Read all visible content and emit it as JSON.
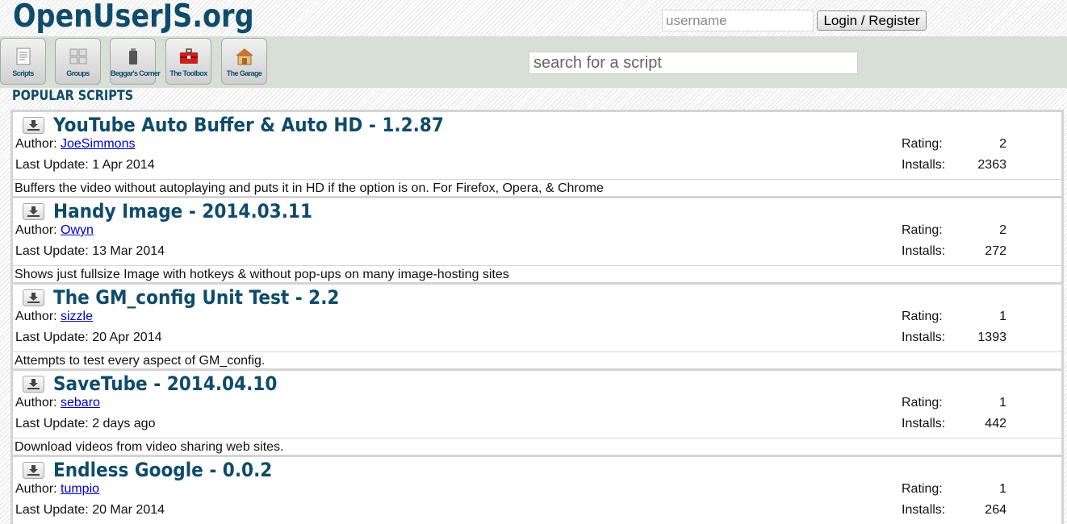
{
  "header": {
    "logo": "OpenUserJS.org",
    "username_placeholder": "username",
    "login_label": "Login / Register"
  },
  "nav": {
    "items": [
      {
        "label": "Scripts",
        "icon": "document-icon"
      },
      {
        "label": "Groups",
        "icon": "grid-icon"
      },
      {
        "label": "Beggar's Corner",
        "icon": "cup-icon"
      },
      {
        "label": "The Toolbox",
        "icon": "toolbox-icon"
      },
      {
        "label": "The Garage",
        "icon": "house-icon"
      }
    ],
    "search_placeholder": "search for a script"
  },
  "section_title": "POPULAR SCRIPTS",
  "labels": {
    "author": "Author:",
    "last_update": "Last Update:",
    "rating": "Rating:",
    "installs": "Installs:"
  },
  "scripts": [
    {
      "title": "YouTube Auto Buffer & Auto HD - 1.2.87",
      "author": "JoeSimmons",
      "last_update": "1 Apr 2014",
      "rating": "2",
      "installs": "2363",
      "description": "Buffers the video without autoplaying and puts it in HD if the option is on. For Firefox, Opera, & Chrome"
    },
    {
      "title": "Handy Image - 2014.03.11",
      "author": "Owyn",
      "last_update": "13 Mar 2014",
      "rating": "2",
      "installs": "272",
      "description": "Shows just fullsize Image with hotkeys & without pop-ups on many image-hosting sites"
    },
    {
      "title": "The GM_config Unit Test - 2.2",
      "author": "sizzle",
      "last_update": "20 Apr 2014",
      "rating": "1",
      "installs": "1393",
      "description": "Attempts to test every aspect of GM_config."
    },
    {
      "title": "SaveTube - 2014.04.10",
      "author": "sebaro",
      "last_update": "2 days ago",
      "rating": "1",
      "installs": "442",
      "description": "Download videos from video sharing web sites."
    },
    {
      "title": "Endless Google - 0.0.2",
      "author": "tumpio",
      "last_update": "20 Mar 2014",
      "rating": "1",
      "installs": "264",
      "description": ""
    }
  ],
  "colors": {
    "brand": "#0f4b6b",
    "nav_bg": "#d7dfd7",
    "link": "#0000cc"
  }
}
